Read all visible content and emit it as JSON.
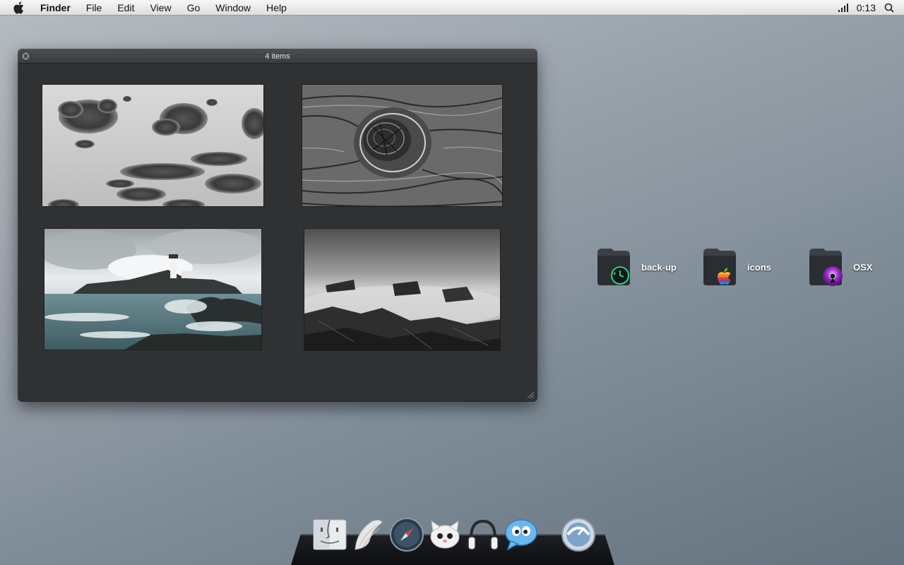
{
  "menubar": {
    "app_name": "Finder",
    "items": [
      "File",
      "Edit",
      "View",
      "Go",
      "Window",
      "Help"
    ],
    "clock": "0:13"
  },
  "window": {
    "title": "4 items",
    "thumbnails": [
      "clouds-photo",
      "wood-knot-photo",
      "lighthouse-seascape-photo",
      "rocky-shore-photo"
    ]
  },
  "desktop": {
    "icons": [
      {
        "label": "back-up",
        "badge": "time-machine"
      },
      {
        "label": "icons",
        "badge": "rainbow-apple"
      },
      {
        "label": "OSX",
        "badge": "purple-disc"
      }
    ]
  },
  "dock": {
    "items": [
      "finder",
      "wings",
      "safari",
      "cat-mascot",
      "headphones",
      "chat-bubble",
      "app-dial"
    ]
  },
  "colors": {
    "window_bg": "#2f3133",
    "desktop_gradient_start": "#b6bcc2",
    "desktop_gradient_end": "#64737f",
    "timemachine_green": "#2fd07a",
    "disc_purple": "#9a2bc9"
  }
}
